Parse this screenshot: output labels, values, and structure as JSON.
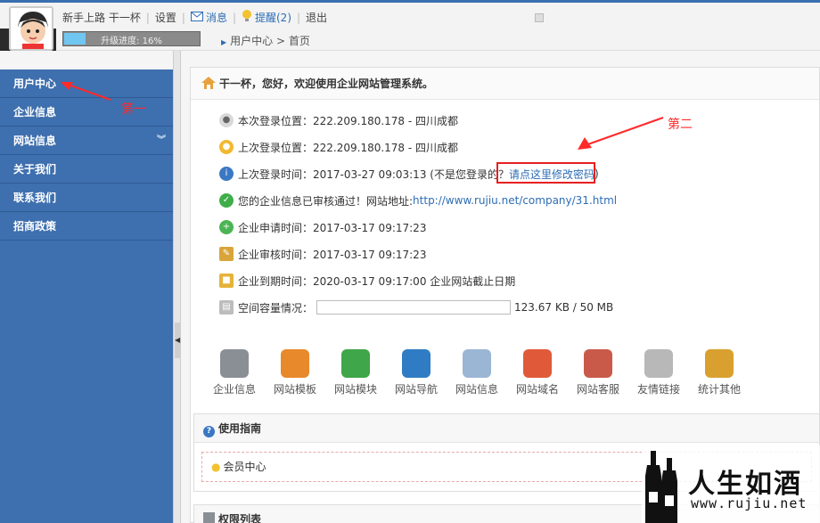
{
  "header": {
    "username": "新手上路 干一杯",
    "settings": "设置",
    "messages": "消息",
    "reminders": "提醒(2)",
    "logout": "退出",
    "progress_label": "升级进度: 16%",
    "progress_value": 0.16
  },
  "breadcrumb": {
    "items": [
      "用户中心",
      "首页"
    ]
  },
  "sidebar": {
    "items": [
      {
        "label": "用户中心"
      },
      {
        "label": "企业信息"
      },
      {
        "label": "网站信息"
      },
      {
        "label": "关于我们"
      },
      {
        "label": "联系我们"
      },
      {
        "label": "招商政策"
      }
    ],
    "annotation": "第一"
  },
  "main": {
    "welcome": "干一杯，您好，欢迎使用企业网站管理系统。",
    "annotation": "第二",
    "info": {
      "current_login": "本次登录位置：222.209.180.178 - 四川成都",
      "last_login": "上次登录位置：222.209.180.178 - 四川成都",
      "last_login_time_prefix": "上次登录时间：2017-03-27 09:03:13 (不是您登录的？",
      "change_password_link": "请点这里修改密码",
      "last_login_time_suffix": ")",
      "company_verified_prefix": "您的企业信息已审核通过！网站地址: ",
      "company_url": "http://www.rujiu.net/company/31.html",
      "apply_time": "企业申请时间：2017-03-17 09:17:23",
      "review_time": "企业审核时间：2017-03-17 09:17:23",
      "expire_time": "企业到期时间：2020-03-17 09:17:00 企业网站截止日期",
      "space_label": "空间容量情况：",
      "space_usage": "123.67 KB / 50 MB"
    },
    "shortcuts": [
      {
        "label": "企业信息",
        "color": "#8a8f96"
      },
      {
        "label": "网站模板",
        "color": "#e8892b"
      },
      {
        "label": "网站模块",
        "color": "#3fa64a"
      },
      {
        "label": "网站导航",
        "color": "#2f7cc4"
      },
      {
        "label": "网站信息",
        "color": "#9bb5d4"
      },
      {
        "label": "网站域名",
        "color": "#e05a3a"
      },
      {
        "label": "网站客服",
        "color": "#c95a4a"
      },
      {
        "label": "友情链接",
        "color": "#b8b8b8"
      },
      {
        "label": "统计其他",
        "color": "#d9a030"
      }
    ],
    "guide": {
      "title": "使用指南",
      "item": "会员中心"
    },
    "permissions": {
      "title": "权限列表"
    }
  },
  "brand": {
    "title": "人生如酒",
    "url": "www.rujiu.net"
  }
}
